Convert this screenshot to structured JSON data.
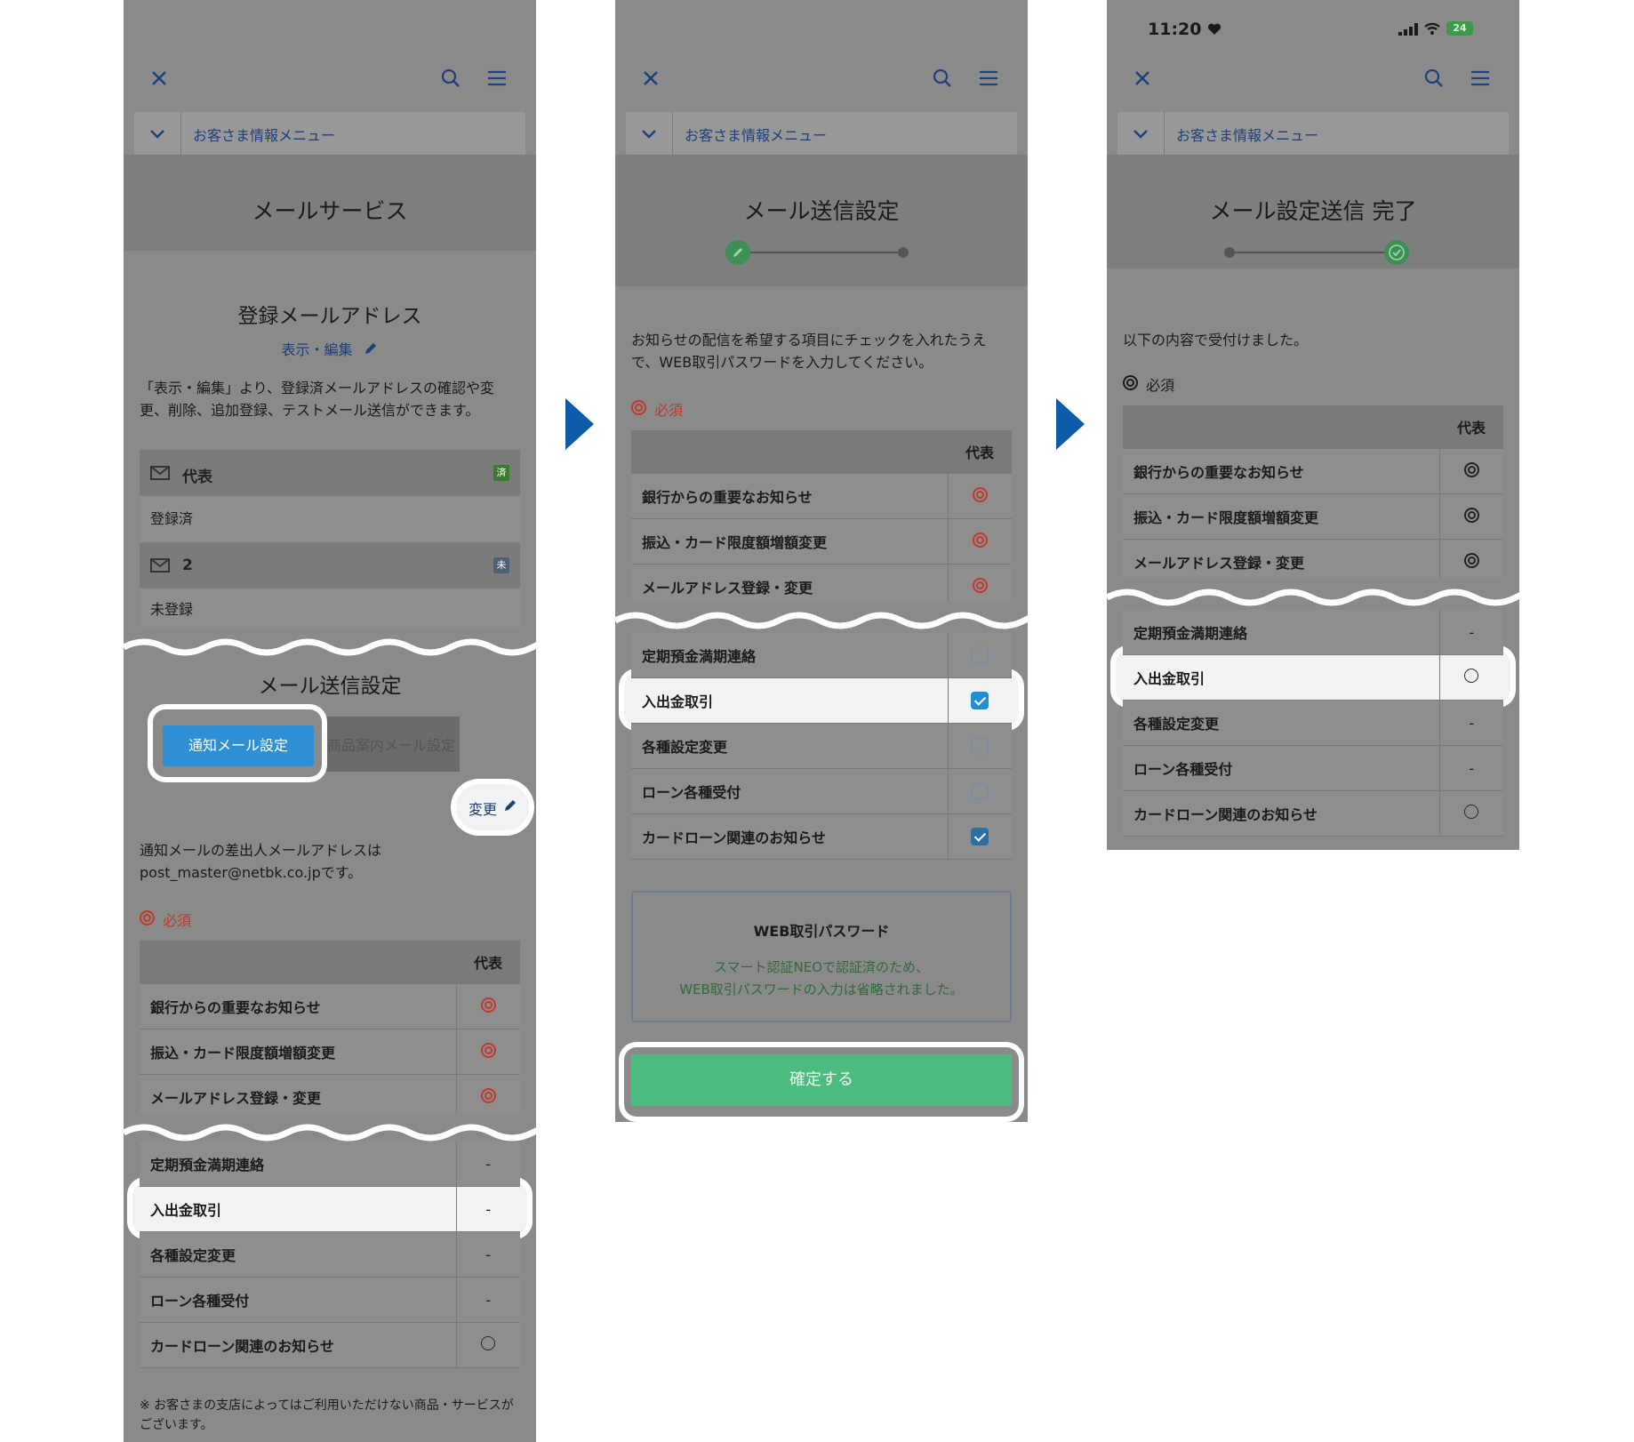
{
  "common": {
    "menu_label": "お客さま情報メニュー",
    "close_icon": "close-icon",
    "search_icon": "search-icon",
    "hamburger_icon": "hamburger-menu-icon",
    "col_header": "代表",
    "accent_navy": "#1d3f7a",
    "arrow_color": "#0d5ba8"
  },
  "screen1": {
    "title": "メールサービス",
    "section_title": "登録メールアドレス",
    "view_edit": "表示・編集",
    "desc": "「表示・編集」より、登録済メールアドレスの確認や変更、削除、追加登録、テストメール送信ができます。",
    "mail1": {
      "name": "代表",
      "badge": "済",
      "status": "登録済"
    },
    "mail2": {
      "name": "2",
      "badge": "未",
      "status": "未登録"
    },
    "send_title": "メール送信設定",
    "tab_active": "通知メール設定",
    "tab_inactive": "商品案内メール設定",
    "change": "変更",
    "sender_text": "通知メールの差出人メールアドレスは post_master@netbk.co.jpです。",
    "required": "必須",
    "rows_top": [
      {
        "name": "銀行からの重要なお知らせ",
        "val": "required"
      },
      {
        "name": "振込・カード限度額増額変更",
        "val": "required"
      },
      {
        "name": "メールアドレス登録・変更",
        "val": "required"
      }
    ],
    "rows_bottom": [
      {
        "name": "定期預金満期連絡",
        "val": "-"
      },
      {
        "name": "入出金取引",
        "val": "-"
      },
      {
        "name": "各種設定変更",
        "val": "-"
      },
      {
        "name": "ローン各種受付",
        "val": "-"
      },
      {
        "name": "カードローン関連のお知らせ",
        "val": "circle"
      }
    ],
    "note": "※ お客さまの支店によってはご利用いただけない商品・サービスがございます。"
  },
  "screen2": {
    "title": "メール送信設定",
    "desc": "お知らせの配信を希望する項目にチェックを入れたうえで、WEB取引パスワードを入力してください。",
    "required": "必須",
    "rows_top": [
      {
        "name": "銀行からの重要なお知らせ",
        "val": "required"
      },
      {
        "name": "振込・カード限度額増額変更",
        "val": "required"
      },
      {
        "name": "メールアドレス登録・変更",
        "val": "required"
      }
    ],
    "rows_bottom": [
      {
        "name": "定期預金満期連絡",
        "checked": false
      },
      {
        "name": "入出金取引",
        "checked": true
      },
      {
        "name": "各種設定変更",
        "checked": false
      },
      {
        "name": "ローン各種受付",
        "checked": false
      },
      {
        "name": "カードローン関連のお知らせ",
        "checked": true
      }
    ],
    "pw_title": "WEB取引パスワード",
    "pw_msg_1": "スマート認証NEOで認証済のため、",
    "pw_msg_2": "WEB取引パスワードの入力は省略されました。",
    "confirm": "確定する"
  },
  "screen3": {
    "time": "11:20",
    "battery": "24",
    "title": "メール設定送信 完了",
    "desc": "以下の内容で受付けました。",
    "required": "必須",
    "rows_top": [
      {
        "name": "銀行からの重要なお知らせ",
        "val": "required"
      },
      {
        "name": "振込・カード限度額増額変更",
        "val": "required"
      },
      {
        "name": "メールアドレス登録・変更",
        "val": "required"
      }
    ],
    "rows_bottom": [
      {
        "name": "定期預金満期連絡",
        "val": "-"
      },
      {
        "name": "入出金取引",
        "val": "circle"
      },
      {
        "name": "各種設定変更",
        "val": "-"
      },
      {
        "name": "ローン各種受付",
        "val": "-"
      },
      {
        "name": "カードローン関連のお知らせ",
        "val": "circle"
      }
    ]
  }
}
